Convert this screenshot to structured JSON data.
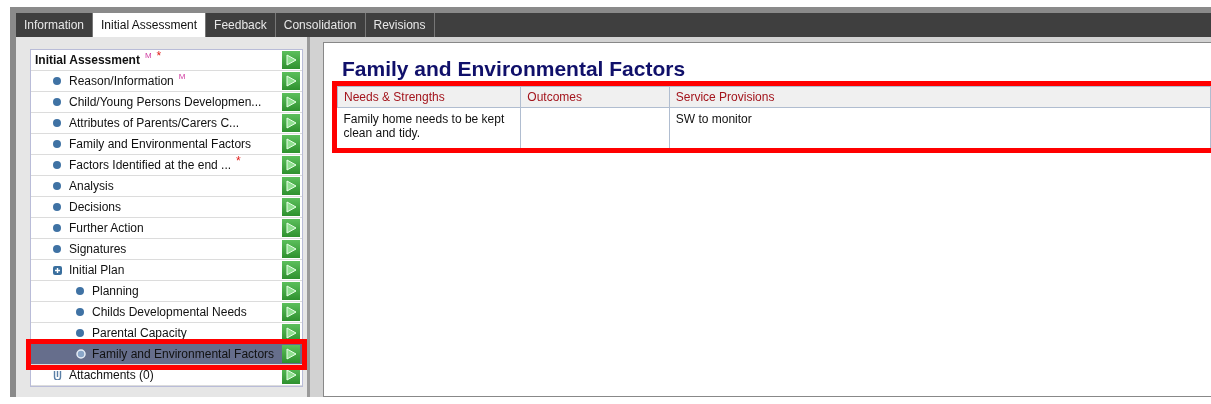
{
  "tabs": [
    {
      "label": "Information",
      "selected": false
    },
    {
      "label": "Initial Assessment",
      "selected": true
    },
    {
      "label": "Feedback",
      "selected": false
    },
    {
      "label": "Consolidation",
      "selected": false
    },
    {
      "label": "Revisions",
      "selected": false
    }
  ],
  "sidebar": {
    "items": [
      {
        "kind": "header",
        "label": "Initial Assessment",
        "selected": false,
        "highlighted": false,
        "badges": [
          {
            "kind": "m",
            "text": "M"
          },
          {
            "kind": "required",
            "text": "*"
          }
        ]
      },
      {
        "kind": "bullet",
        "label": "Reason/Information",
        "selected": false,
        "highlighted": false,
        "badges": [
          {
            "kind": "m",
            "text": "M"
          }
        ]
      },
      {
        "kind": "bullet",
        "label": "Child/Young Persons Developmen...",
        "selected": false,
        "highlighted": false
      },
      {
        "kind": "bullet",
        "label": "Attributes of Parents/Carers C...",
        "selected": false,
        "highlighted": false
      },
      {
        "kind": "bullet",
        "label": "Family and Environmental Factors",
        "selected": false,
        "highlighted": false
      },
      {
        "kind": "bullet",
        "label": "Factors Identified at the end ...",
        "selected": false,
        "highlighted": false,
        "badges": [
          {
            "kind": "required",
            "text": "*"
          }
        ]
      },
      {
        "kind": "bullet",
        "label": "Analysis",
        "selected": false,
        "highlighted": false
      },
      {
        "kind": "bullet",
        "label": "Decisions",
        "selected": false,
        "highlighted": false
      },
      {
        "kind": "bullet",
        "label": "Further Action",
        "selected": false,
        "highlighted": false
      },
      {
        "kind": "bullet",
        "label": "Signatures",
        "selected": false,
        "highlighted": false
      },
      {
        "kind": "expander",
        "label": "Initial Plan",
        "selected": false,
        "highlighted": false,
        "children": [
          {
            "kind": "bullet",
            "label": "Planning",
            "selected": false,
            "highlighted": false
          },
          {
            "kind": "bullet",
            "label": "Childs Developmental Needs",
            "selected": false,
            "highlighted": false
          },
          {
            "kind": "bullet",
            "label": "Parental Capacity",
            "selected": false,
            "highlighted": false
          },
          {
            "kind": "bullet",
            "label": "Family and Environmental Factors",
            "selected": true,
            "highlighted": true
          }
        ]
      },
      {
        "kind": "attachment",
        "label": "Attachments (0)",
        "selected": false,
        "highlighted": false
      }
    ]
  },
  "content": {
    "title": "Family and Environmental Factors",
    "table": {
      "highlighted": true,
      "columns": [
        "Needs & Strengths",
        "Outcomes",
        "Service Provisions"
      ],
      "rows": [
        [
          "Family home needs to be kept clean and tidy.",
          "",
          "SW to monitor"
        ]
      ]
    }
  }
}
